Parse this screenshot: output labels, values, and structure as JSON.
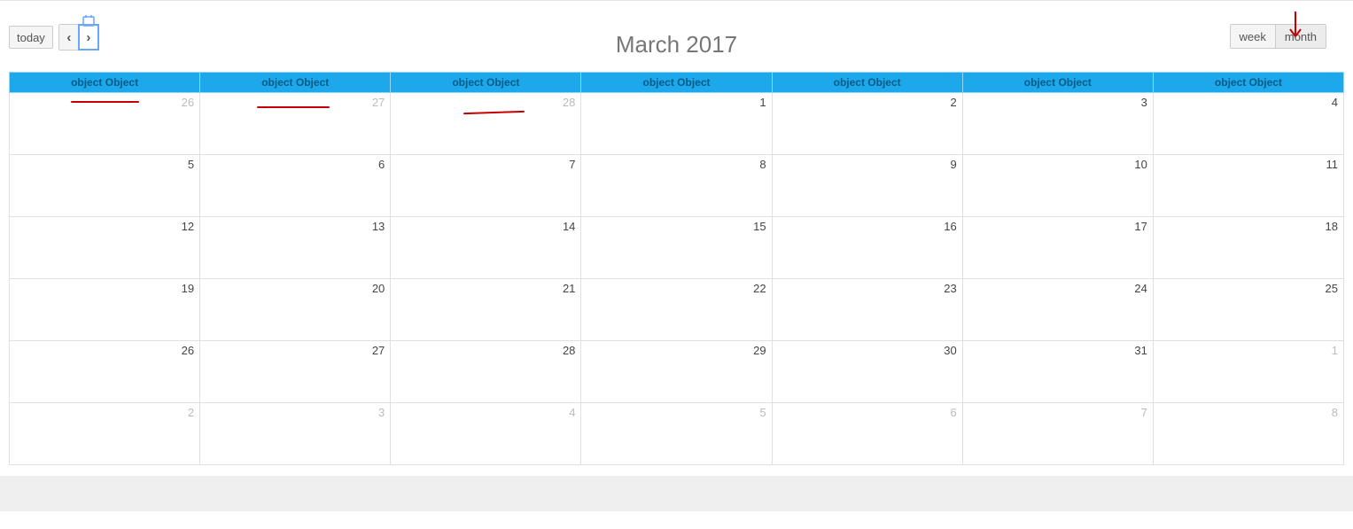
{
  "toolbar": {
    "today_label": "today",
    "prev_glyph": "‹",
    "next_glyph": "›",
    "views": {
      "week": "week",
      "month": "month"
    }
  },
  "title": "March 2017",
  "day_headers": [
    "object Object",
    "object Object",
    "object Object",
    "object Object",
    "object Object",
    "object Object",
    "object Object"
  ],
  "weeks": [
    [
      {
        "n": "26",
        "other": true
      },
      {
        "n": "27",
        "other": true
      },
      {
        "n": "28",
        "other": true
      },
      {
        "n": "1"
      },
      {
        "n": "2"
      },
      {
        "n": "3"
      },
      {
        "n": "4"
      }
    ],
    [
      {
        "n": "5"
      },
      {
        "n": "6"
      },
      {
        "n": "7"
      },
      {
        "n": "8"
      },
      {
        "n": "9"
      },
      {
        "n": "10"
      },
      {
        "n": "11"
      }
    ],
    [
      {
        "n": "12"
      },
      {
        "n": "13"
      },
      {
        "n": "14"
      },
      {
        "n": "15"
      },
      {
        "n": "16"
      },
      {
        "n": "17"
      },
      {
        "n": "18"
      }
    ],
    [
      {
        "n": "19"
      },
      {
        "n": "20"
      },
      {
        "n": "21"
      },
      {
        "n": "22"
      },
      {
        "n": "23"
      },
      {
        "n": "24"
      },
      {
        "n": "25"
      }
    ],
    [
      {
        "n": "26"
      },
      {
        "n": "27"
      },
      {
        "n": "28"
      },
      {
        "n": "29"
      },
      {
        "n": "30"
      },
      {
        "n": "31"
      },
      {
        "n": "1",
        "other": true
      }
    ],
    [
      {
        "n": "2",
        "other": true
      },
      {
        "n": "3",
        "other": true
      },
      {
        "n": "4",
        "other": true
      },
      {
        "n": "5",
        "other": true
      },
      {
        "n": "6",
        "other": true
      },
      {
        "n": "7",
        "other": true
      },
      {
        "n": "8",
        "other": true
      }
    ]
  ]
}
